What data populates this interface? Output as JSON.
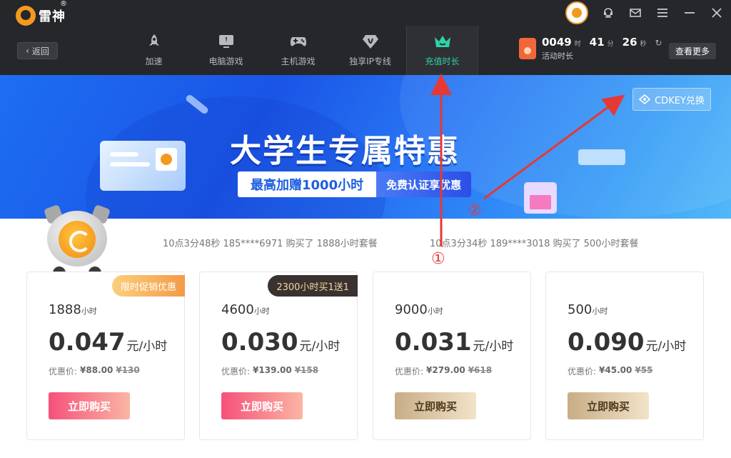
{
  "app": {
    "logo_text": "雷神",
    "logo_reg": "®"
  },
  "header": {
    "back_label": "返回",
    "nav": [
      {
        "label": "加速",
        "icon": "rocket-icon"
      },
      {
        "label": "电脑游戏",
        "icon": "monitor-game-icon"
      },
      {
        "label": "主机游戏",
        "icon": "gamepad-icon"
      },
      {
        "label": "独享IP专线",
        "icon": "ip-line-icon"
      },
      {
        "label": "充值时长",
        "icon": "crown-icon",
        "active": true
      }
    ],
    "timer": {
      "hours": "0049",
      "hours_unit": "时",
      "minutes": "41",
      "minutes_unit": "分",
      "seconds": "26",
      "seconds_unit": "秒",
      "label": "活动时长"
    },
    "more_label": "查看更多",
    "accent": "#2fd3a8"
  },
  "banner": {
    "title": "大学生专属特惠",
    "subtitle": "最高加赠1000小时",
    "tag": "免费认证享优惠",
    "cdkey_label": "CDKEY兑换"
  },
  "ticker": [
    "10点3分48秒 185****6971 购买了 1888小时套餐",
    "10点3分34秒 189****3018 购买了 500小时套餐"
  ],
  "annotations": {
    "one": "①",
    "two": "②"
  },
  "cards": [
    {
      "hours": "1888",
      "hours_unit": "小时",
      "price": "0.047",
      "price_unit": "元/小时",
      "promo_label": "优惠价:",
      "promo_price": "¥88.00",
      "old_price": "¥130",
      "badge": "限时促销优惠",
      "buy": "立即购买"
    },
    {
      "hours": "4600",
      "hours_unit": "小时",
      "price": "0.030",
      "price_unit": "元/小时",
      "promo_label": "优惠价:",
      "promo_price": "¥139.00",
      "old_price": "¥158",
      "badge": "2300小时买1送1",
      "buy": "立即购买"
    },
    {
      "hours": "9000",
      "hours_unit": "小时",
      "price": "0.031",
      "price_unit": "元/小时",
      "promo_label": "优惠价:",
      "promo_price": "¥279.00",
      "old_price": "¥618",
      "badge": "",
      "buy": "立即购买"
    },
    {
      "hours": "500",
      "hours_unit": "小时",
      "price": "0.090",
      "price_unit": "元/小时",
      "promo_label": "优惠价:",
      "promo_price": "¥45.00",
      "old_price": "¥55",
      "badge": "",
      "buy": "立即购买"
    }
  ]
}
